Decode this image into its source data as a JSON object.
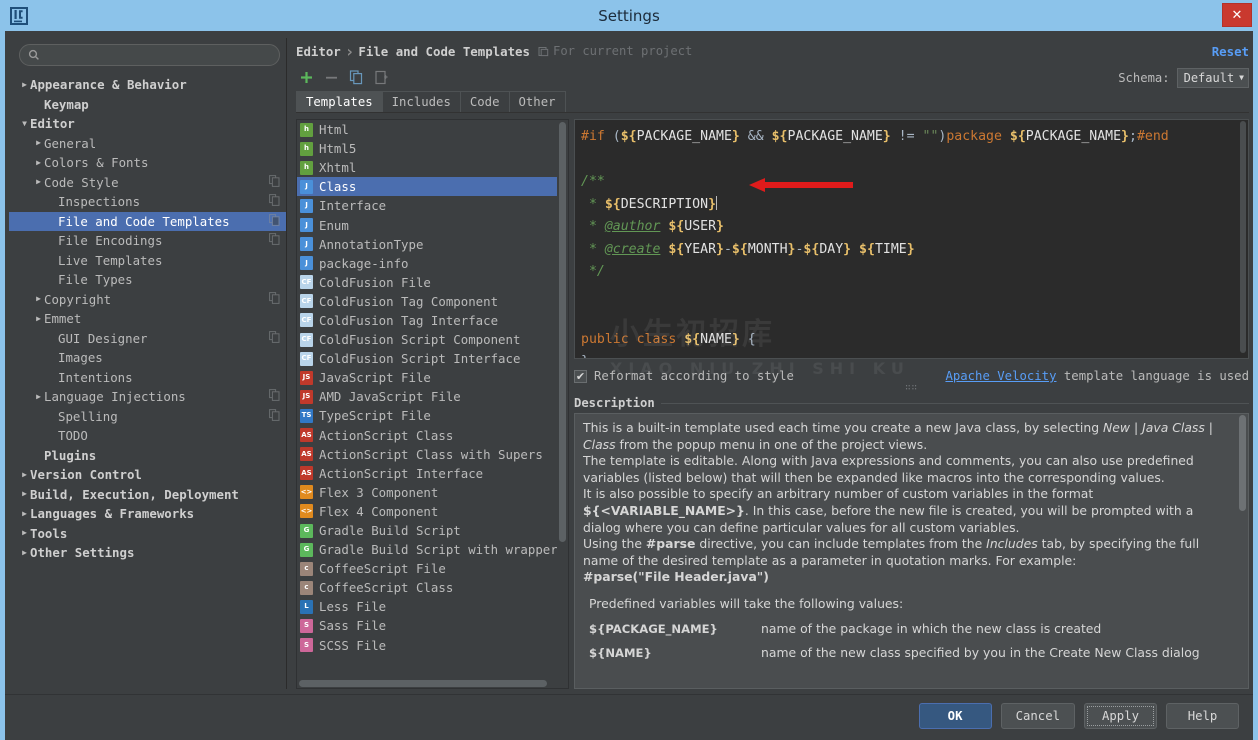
{
  "window": {
    "title": "Settings",
    "app_icon": "jetbrains-logo-icon",
    "close_label": "✕"
  },
  "search": {
    "value": "",
    "placeholder": "",
    "icon": "search-icon"
  },
  "tree": {
    "items": [
      {
        "label": "Appearance & Behavior",
        "twisty": "▶",
        "indent": 0,
        "bold": true,
        "selected": false,
        "copy": false
      },
      {
        "label": "Keymap",
        "twisty": "",
        "indent": 1,
        "bold": true,
        "selected": false,
        "copy": false
      },
      {
        "label": "Editor",
        "twisty": "▼",
        "indent": 0,
        "bold": true,
        "selected": false,
        "copy": false
      },
      {
        "label": "General",
        "twisty": "▶",
        "indent": 1,
        "bold": false,
        "selected": false,
        "copy": false
      },
      {
        "label": "Colors & Fonts",
        "twisty": "▶",
        "indent": 1,
        "bold": false,
        "selected": false,
        "copy": false
      },
      {
        "label": "Code Style",
        "twisty": "▶",
        "indent": 1,
        "bold": false,
        "selected": false,
        "copy": true
      },
      {
        "label": "Inspections",
        "twisty": "",
        "indent": 2,
        "bold": false,
        "selected": false,
        "copy": true
      },
      {
        "label": "File and Code Templates",
        "twisty": "",
        "indent": 2,
        "bold": false,
        "selected": true,
        "copy": true
      },
      {
        "label": "File Encodings",
        "twisty": "",
        "indent": 2,
        "bold": false,
        "selected": false,
        "copy": true
      },
      {
        "label": "Live Templates",
        "twisty": "",
        "indent": 2,
        "bold": false,
        "selected": false,
        "copy": false
      },
      {
        "label": "File Types",
        "twisty": "",
        "indent": 2,
        "bold": false,
        "selected": false,
        "copy": false
      },
      {
        "label": "Copyright",
        "twisty": "▶",
        "indent": 1,
        "bold": false,
        "selected": false,
        "copy": true
      },
      {
        "label": "Emmet",
        "twisty": "▶",
        "indent": 1,
        "bold": false,
        "selected": false,
        "copy": false
      },
      {
        "label": "GUI Designer",
        "twisty": "",
        "indent": 2,
        "bold": false,
        "selected": false,
        "copy": true
      },
      {
        "label": "Images",
        "twisty": "",
        "indent": 2,
        "bold": false,
        "selected": false,
        "copy": false
      },
      {
        "label": "Intentions",
        "twisty": "",
        "indent": 2,
        "bold": false,
        "selected": false,
        "copy": false
      },
      {
        "label": "Language Injections",
        "twisty": "▶",
        "indent": 1,
        "bold": false,
        "selected": false,
        "copy": true
      },
      {
        "label": "Spelling",
        "twisty": "",
        "indent": 2,
        "bold": false,
        "selected": false,
        "copy": true
      },
      {
        "label": "TODO",
        "twisty": "",
        "indent": 2,
        "bold": false,
        "selected": false,
        "copy": false
      },
      {
        "label": "Plugins",
        "twisty": "",
        "indent": 1,
        "bold": true,
        "selected": false,
        "copy": false
      },
      {
        "label": "Version Control",
        "twisty": "▶",
        "indent": 0,
        "bold": true,
        "selected": false,
        "copy": false
      },
      {
        "label": "Build, Execution, Deployment",
        "twisty": "▶",
        "indent": 0,
        "bold": true,
        "selected": false,
        "copy": false
      },
      {
        "label": "Languages & Frameworks",
        "twisty": "▶",
        "indent": 0,
        "bold": true,
        "selected": false,
        "copy": false
      },
      {
        "label": "Tools",
        "twisty": "▶",
        "indent": 0,
        "bold": true,
        "selected": false,
        "copy": false
      },
      {
        "label": "Other Settings",
        "twisty": "▶",
        "indent": 0,
        "bold": true,
        "selected": false,
        "copy": false
      }
    ]
  },
  "header": {
    "crumb_root": "Editor",
    "crumb_sep": "›",
    "crumb_leaf": "File and Code Templates",
    "scope_note": "For current project",
    "scope_icon": "project-scope-icon",
    "reset_label": "Reset",
    "schema_label": "Schema:",
    "schema_value": "Default",
    "schema_caret": "▼"
  },
  "toolbar": {
    "buttons": [
      {
        "name": "add-template-button",
        "icon": "plus-icon",
        "glyph": "+"
      },
      {
        "name": "remove-template-button",
        "icon": "minus-icon",
        "glyph": "−"
      },
      {
        "name": "copy-template-button",
        "icon": "copy-file-icon",
        "glyph": ""
      },
      {
        "name": "reset-to-default-button",
        "icon": "revert-file-icon",
        "glyph": ""
      }
    ]
  },
  "tabs": [
    {
      "label": "Templates",
      "active": true
    },
    {
      "label": "Includes",
      "active": false
    },
    {
      "label": "Code",
      "active": false
    },
    {
      "label": "Other",
      "active": false
    }
  ],
  "templates": [
    {
      "label": "Html",
      "icon": "html-file-icon",
      "badge": "h",
      "color": "#62a03f",
      "selected": false
    },
    {
      "label": "Html5",
      "icon": "html5-file-icon",
      "badge": "h",
      "color": "#62a03f",
      "selected": false
    },
    {
      "label": "Xhtml",
      "icon": "xhtml-file-icon",
      "badge": "h",
      "color": "#62a03f",
      "selected": false
    },
    {
      "label": "Class",
      "icon": "java-class-icon",
      "badge": "J",
      "color": "#4a90d9",
      "selected": true
    },
    {
      "label": "Interface",
      "icon": "java-interface-icon",
      "badge": "J",
      "color": "#4a90d9",
      "selected": false
    },
    {
      "label": "Enum",
      "icon": "java-enum-icon",
      "badge": "J",
      "color": "#4a90d9",
      "selected": false
    },
    {
      "label": "AnnotationType",
      "icon": "java-annotation-icon",
      "badge": "J",
      "color": "#4a90d9",
      "selected": false
    },
    {
      "label": "package-info",
      "icon": "java-package-icon",
      "badge": "J",
      "color": "#4a90d9",
      "selected": false
    },
    {
      "label": "ColdFusion File",
      "icon": "coldfusion-file-icon",
      "badge": "CF",
      "color": "#b9d4ea",
      "selected": false
    },
    {
      "label": "ColdFusion Tag Component",
      "icon": "coldfusion-file-icon",
      "badge": "CF",
      "color": "#b9d4ea",
      "selected": false
    },
    {
      "label": "ColdFusion Tag Interface",
      "icon": "coldfusion-file-icon",
      "badge": "CF",
      "color": "#b9d4ea",
      "selected": false
    },
    {
      "label": "ColdFusion Script Component",
      "icon": "coldfusion-file-icon",
      "badge": "CF",
      "color": "#b9d4ea",
      "selected": false
    },
    {
      "label": "ColdFusion Script Interface",
      "icon": "coldfusion-file-icon",
      "badge": "CF",
      "color": "#b9d4ea",
      "selected": false
    },
    {
      "label": "JavaScript File",
      "icon": "javascript-file-icon",
      "badge": "JS",
      "color": "#c0392b",
      "selected": false
    },
    {
      "label": "AMD JavaScript File",
      "icon": "javascript-file-icon",
      "badge": "JS",
      "color": "#c0392b",
      "selected": false
    },
    {
      "label": "TypeScript File",
      "icon": "typescript-file-icon",
      "badge": "TS",
      "color": "#3178c6",
      "selected": false
    },
    {
      "label": "ActionScript Class",
      "icon": "actionscript-file-icon",
      "badge": "AS",
      "color": "#c0392b",
      "selected": false
    },
    {
      "label": "ActionScript Class with Supers",
      "icon": "actionscript-file-icon",
      "badge": "AS",
      "color": "#c0392b",
      "selected": false
    },
    {
      "label": "ActionScript Interface",
      "icon": "actionscript-file-icon",
      "badge": "AS",
      "color": "#c0392b",
      "selected": false
    },
    {
      "label": "Flex 3 Component",
      "icon": "flex-component-icon",
      "badge": "<>",
      "color": "#e08a1e",
      "selected": false
    },
    {
      "label": "Flex 4 Component",
      "icon": "flex-component-icon",
      "badge": "<>",
      "color": "#e08a1e",
      "selected": false
    },
    {
      "label": "Gradle Build Script",
      "icon": "gradle-file-icon",
      "badge": "G",
      "color": "#5cb85c",
      "selected": false
    },
    {
      "label": "Gradle Build Script with wrapper",
      "icon": "gradle-file-icon",
      "badge": "G",
      "color": "#5cb85c",
      "selected": false
    },
    {
      "label": "CoffeeScript File",
      "icon": "coffeescript-file-icon",
      "badge": "c",
      "color": "#9b8579",
      "selected": false
    },
    {
      "label": "CoffeeScript Class",
      "icon": "coffeescript-file-icon",
      "badge": "c",
      "color": "#9b8579",
      "selected": false
    },
    {
      "label": "Less File",
      "icon": "less-file-icon",
      "badge": "L",
      "color": "#2a72b5",
      "selected": false
    },
    {
      "label": "Sass File",
      "icon": "sass-file-icon",
      "badge": "S",
      "color": "#cd6799",
      "selected": false
    },
    {
      "label": "SCSS File",
      "icon": "scss-file-icon",
      "badge": "S",
      "color": "#cd6799",
      "selected": false
    }
  ],
  "editor": {
    "lines": [
      {
        "tokens": [
          {
            "t": "#if ",
            "c": "v-dir"
          },
          {
            "t": "(",
            "c": "v-op"
          },
          {
            "t": "${",
            "c": "v-var"
          },
          {
            "t": "PACKAGE_NAME",
            "c": "v-name"
          },
          {
            "t": "}",
            "c": "v-var"
          },
          {
            "t": " && ",
            "c": "v-op"
          },
          {
            "t": "${",
            "c": "v-var"
          },
          {
            "t": "PACKAGE_NAME",
            "c": "v-name"
          },
          {
            "t": "}",
            "c": "v-var"
          },
          {
            "t": " != ",
            "c": "v-op"
          },
          {
            "t": "\"\"",
            "c": "v-str"
          },
          {
            "t": ")",
            "c": "v-op"
          },
          {
            "t": "package",
            "c": "v-dir"
          },
          {
            "t": " ",
            "c": "v-op"
          },
          {
            "t": "${",
            "c": "v-var"
          },
          {
            "t": "PACKAGE_NAME",
            "c": "v-name"
          },
          {
            "t": "}",
            "c": "v-var"
          },
          {
            "t": ";",
            "c": "v-op"
          },
          {
            "t": "#end",
            "c": "v-dir"
          }
        ]
      },
      {
        "tokens": []
      },
      {
        "tokens": [
          {
            "t": "/**",
            "c": "v-com"
          }
        ]
      },
      {
        "tokens": [
          {
            "t": " * ",
            "c": "v-com"
          },
          {
            "t": "${",
            "c": "v-var"
          },
          {
            "t": "DESCRIPTION",
            "c": "v-name"
          },
          {
            "t": "}",
            "c": "v-var"
          },
          {
            "t": "|caret|",
            "c": "caret"
          }
        ]
      },
      {
        "tokens": [
          {
            "t": " * ",
            "c": "v-com"
          },
          {
            "t": "@author",
            "c": "v-tag"
          },
          {
            "t": " ",
            "c": "v-op"
          },
          {
            "t": "${",
            "c": "v-var"
          },
          {
            "t": "USER",
            "c": "v-name"
          },
          {
            "t": "}",
            "c": "v-var"
          }
        ]
      },
      {
        "tokens": [
          {
            "t": " * ",
            "c": "v-com"
          },
          {
            "t": "@create",
            "c": "v-tag"
          },
          {
            "t": " ",
            "c": "v-op"
          },
          {
            "t": "${",
            "c": "v-var"
          },
          {
            "t": "YEAR",
            "c": "v-name"
          },
          {
            "t": "}",
            "c": "v-var"
          },
          {
            "t": "-",
            "c": "v-op"
          },
          {
            "t": "${",
            "c": "v-var"
          },
          {
            "t": "MONTH",
            "c": "v-name"
          },
          {
            "t": "}",
            "c": "v-var"
          },
          {
            "t": "-",
            "c": "v-op"
          },
          {
            "t": "${",
            "c": "v-var"
          },
          {
            "t": "DAY",
            "c": "v-name"
          },
          {
            "t": "}",
            "c": "v-var"
          },
          {
            "t": " ",
            "c": "v-op"
          },
          {
            "t": "${",
            "c": "v-var"
          },
          {
            "t": "TIME",
            "c": "v-name"
          },
          {
            "t": "}",
            "c": "v-var"
          }
        ]
      },
      {
        "tokens": [
          {
            "t": " */",
            "c": "v-com"
          }
        ]
      },
      {
        "tokens": []
      },
      {
        "tokens": []
      },
      {
        "tokens": [
          {
            "t": "public class",
            "c": "v-kw"
          },
          {
            "t": " ",
            "c": "v-op"
          },
          {
            "t": "${",
            "c": "v-var"
          },
          {
            "t": "NAME",
            "c": "v-name"
          },
          {
            "t": "}",
            "c": "v-var"
          },
          {
            "t": " {",
            "c": "v-op"
          }
        ]
      },
      {
        "tokens": [
          {
            "t": "}",
            "c": "v-op"
          }
        ]
      }
    ],
    "annotation": {
      "name": "red-arrow-annotation",
      "color": "#e01b1b"
    }
  },
  "options": {
    "reformat_label": "Reformat according to style",
    "reformat_checked": true,
    "check_glyph": "✔",
    "velocity_link": "Apache Velocity",
    "velocity_suffix": " template language is used",
    "grip": "∷∷"
  },
  "description": {
    "heading": "Description",
    "paragraphs": [
      {
        "type": "rich",
        "parts": [
          {
            "t": "This is a built-in template used each time you create a new Java class, by selecting "
          },
          {
            "t": "New",
            "s": "it"
          },
          {
            "t": " | "
          },
          {
            "t": "Java Class",
            "s": "it"
          },
          {
            "t": " | "
          },
          {
            "t": "Class",
            "s": "it"
          },
          {
            "t": " from the popup menu in one of the project views."
          }
        ]
      },
      {
        "type": "rich",
        "parts": [
          {
            "t": "The template is editable. Along with Java expressions and comments, you can also use predefined variables (listed below) that will then be expanded like macros into the corresponding values."
          }
        ]
      },
      {
        "type": "rich",
        "parts": [
          {
            "t": "It is also possible to specify an arbitrary number of custom variables in the format "
          },
          {
            "t": "${<VARIABLE_NAME>}",
            "s": "bd"
          },
          {
            "t": ". In this case, before the new file is created, you will be prompted with a dialog where you can define particular values for all custom variables."
          }
        ]
      },
      {
        "type": "rich",
        "parts": [
          {
            "t": "Using the "
          },
          {
            "t": "#parse",
            "s": "bd"
          },
          {
            "t": " directive, you can include templates from the "
          },
          {
            "t": "Includes",
            "s": "it"
          },
          {
            "t": " tab, by specifying the full name of the desired template as a parameter in quotation marks. For example:"
          }
        ]
      },
      {
        "type": "rich",
        "parts": [
          {
            "t": "#parse(\"File Header.java\")",
            "s": "bd"
          }
        ]
      },
      {
        "type": "spacer"
      },
      {
        "type": "rich",
        "indent": true,
        "parts": [
          {
            "t": "Predefined variables will take the following values:"
          }
        ]
      }
    ],
    "variables": [
      {
        "name": "${PACKAGE_NAME}",
        "desc": "name of the package in which the new class is created"
      },
      {
        "name": "${NAME}",
        "desc": "name of the new class specified by you in the Create New Class dialog"
      }
    ]
  },
  "buttons": [
    {
      "label": "OK",
      "primary": true,
      "focus": false,
      "name": "ok-button"
    },
    {
      "label": "Cancel",
      "primary": false,
      "focus": false,
      "name": "cancel-button"
    },
    {
      "label": "Apply",
      "primary": false,
      "focus": true,
      "name": "apply-button"
    },
    {
      "label": "Help",
      "primary": false,
      "focus": false,
      "name": "help-button"
    }
  ],
  "watermark": {
    "line1": "小生初招库",
    "line2": "XIAO NIU ZHI SHI KU",
    "icon": "dragon-logo-watermark"
  },
  "colors": {
    "titlebar": "#8cc3ea",
    "panel": "#3c3f41",
    "selection": "#4b6eaf",
    "editor_bg": "#2b2b2b",
    "link": "#589df6",
    "accent_green": "#62a03f",
    "close_red": "#c9392f"
  }
}
